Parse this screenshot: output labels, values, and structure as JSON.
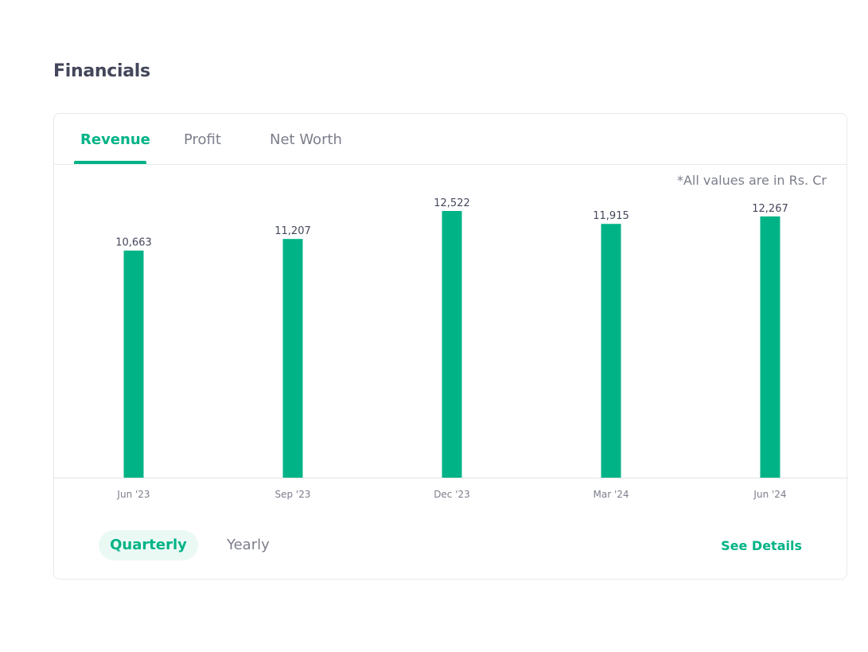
{
  "section": {
    "title": "Financials"
  },
  "tabs": [
    {
      "label": "Revenue",
      "active": true
    },
    {
      "label": "Profit",
      "active": false
    },
    {
      "label": "Net Worth",
      "active": false
    }
  ],
  "unit_note": "*All values are in Rs. Cr",
  "period_toggle": {
    "quarterly_label": "Quarterly",
    "yearly_label": "Yearly",
    "selected": "Quarterly"
  },
  "see_details_label": "See Details",
  "colors": {
    "accent": "#00b386",
    "bar": "#00b386",
    "text": "#44475b",
    "muted": "#7c7e8c"
  },
  "chart_data": {
    "type": "bar",
    "categories": [
      "Jun '23",
      "Sep '23",
      "Dec '23",
      "Mar '24",
      "Jun '24"
    ],
    "values": [
      10663,
      11207,
      12522,
      11915,
      12267
    ],
    "data_labels": [
      "10,663",
      "11,207",
      "12,522",
      "11,915",
      "12,267"
    ],
    "title": "",
    "xlabel": "",
    "ylabel": "",
    "ylim": [
      0,
      12522
    ],
    "grid": false,
    "legend": "none"
  }
}
